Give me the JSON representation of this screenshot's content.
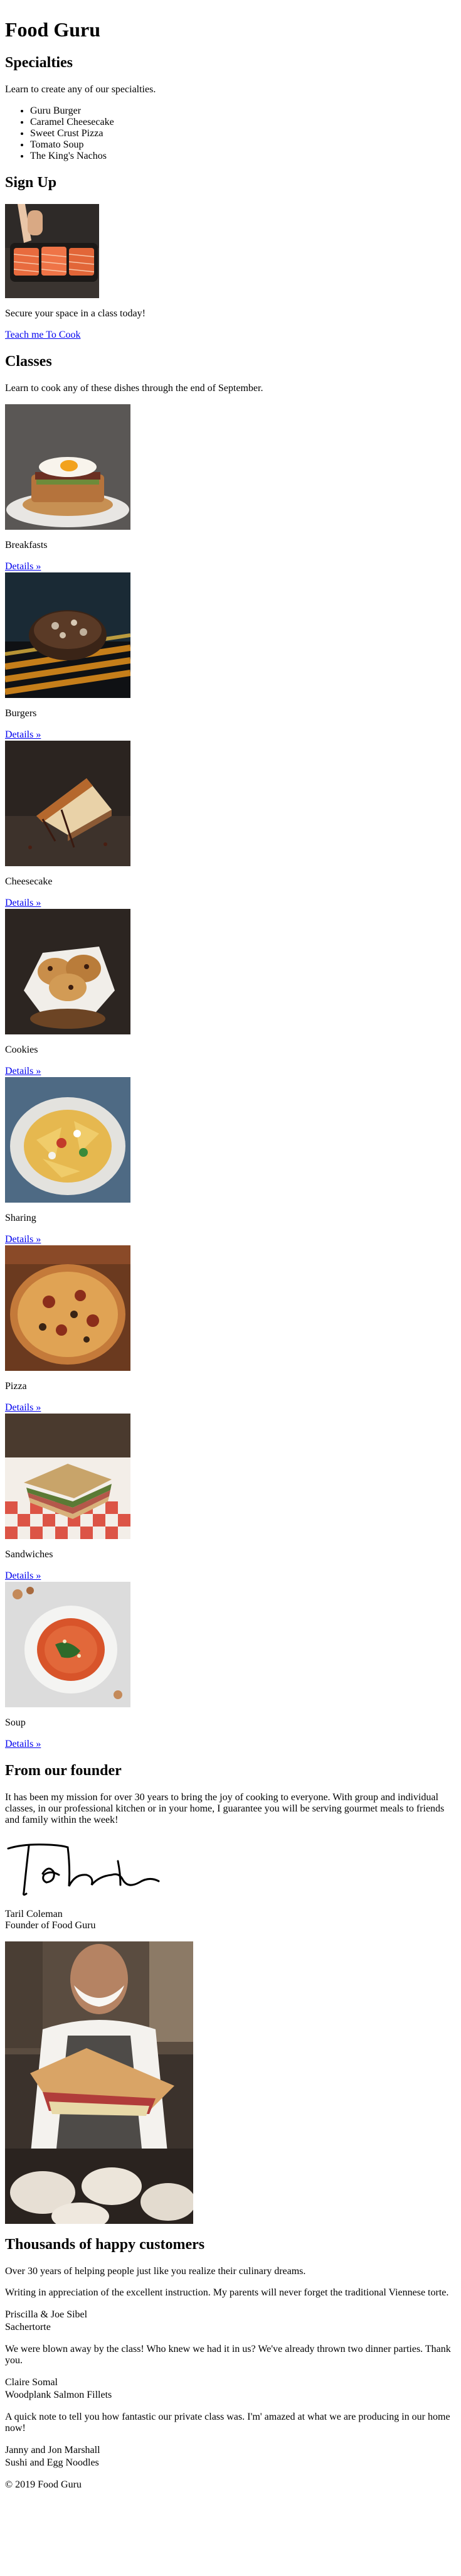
{
  "site": {
    "title": "Food Guru"
  },
  "specialties": {
    "heading": "Specialties",
    "intro": "Learn to create any of our specialties.",
    "items": [
      "Guru Burger",
      "Caramel Cheesecake",
      "Sweet Crust Pizza",
      "Tomato Soup",
      "The King's Nachos"
    ]
  },
  "signup": {
    "heading": "Sign Up",
    "text": "Secure your space in a class today!",
    "link": "Teach me To Cook"
  },
  "classes": {
    "heading": "Classes",
    "intro": "Learn to cook any of these dishes through the end of September.",
    "details_label": "Details »",
    "items": [
      {
        "name": "Breakfasts"
      },
      {
        "name": "Burgers"
      },
      {
        "name": "Cheesecake"
      },
      {
        "name": "Cookies"
      },
      {
        "name": "Sharing"
      },
      {
        "name": "Pizza"
      },
      {
        "name": "Sandwiches"
      },
      {
        "name": "Soup"
      }
    ]
  },
  "founder": {
    "heading": "From our founder",
    "text": "It has been my mission for over 30 years to bring the joy of cooking to everyone. With group and individual classes, in our professional kitchen or in your home, I guarantee you will be serving gourmet meals to friends and family within the week!",
    "name": "Taril Coleman",
    "role": "Founder of Food Guru"
  },
  "customers": {
    "heading": "Thousands of happy customers",
    "intro": "Over 30 years of helping people just like you realize their culinary dreams.",
    "testimonials": [
      {
        "quote": "Writing in appreciation of the excellent instruction. My parents will never forget the traditional Viennese torte.",
        "author": "Priscilla & Joe Sibel",
        "dish": "Sachertorte"
      },
      {
        "quote": "We were blown away by the class! Who knew we had it in us? We've already thrown two dinner parties. Thank you.",
        "author": "Claire Somal",
        "dish": "Woodplank Salmon Fillets"
      },
      {
        "quote": "A quick note to tell you how fantastic our private class was. I'm' amazed at what we are producing in our home now!",
        "author": "Janny and Jon Marshall",
        "dish": "Sushi and Egg Noodles"
      }
    ]
  },
  "footer": {
    "text": "© 2019 Food Guru"
  }
}
